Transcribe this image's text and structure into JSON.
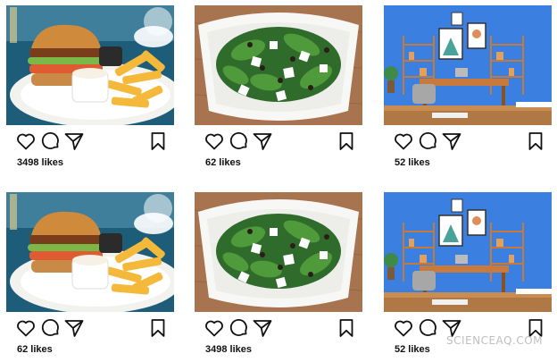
{
  "posts": [
    {
      "photo": "burger-fries-photo",
      "likes": "3498 likes"
    },
    {
      "photo": "salad-bowl-photo",
      "likes": "62 likes"
    },
    {
      "photo": "blue-office-photo",
      "likes": "52 likes"
    },
    {
      "photo": "burger-fries-photo",
      "likes": "62 likes"
    },
    {
      "photo": "salad-bowl-photo",
      "likes": "3498 likes"
    },
    {
      "photo": "blue-office-photo",
      "likes": "52 likes"
    }
  ],
  "icons": {
    "like": "heart-icon",
    "comment": "comment-icon",
    "share": "share-icon",
    "save": "bookmark-icon"
  },
  "watermark": "SCIENCEAQ.COM"
}
